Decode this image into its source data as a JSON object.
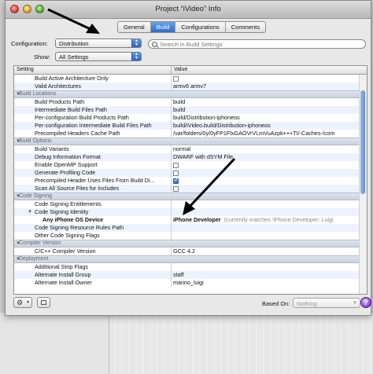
{
  "window": {
    "title": "Project “iVideo” Info"
  },
  "tabs": [
    {
      "label": "General",
      "active": false
    },
    {
      "label": "Build",
      "active": true
    },
    {
      "label": "Configurations",
      "active": false
    },
    {
      "label": "Comments",
      "active": false
    }
  ],
  "configuration": {
    "label": "Configuration:",
    "value": "Distribution"
  },
  "show": {
    "label": "Show:",
    "value": "All Settings"
  },
  "search": {
    "placeholder": "Search in Build Settings"
  },
  "table": {
    "col_setting": "Setting",
    "col_value": "Value",
    "rows": [
      {
        "type": "item",
        "name": "Build Active Architecture Only",
        "checkbox": true,
        "checked": false
      },
      {
        "type": "item",
        "name": "Valid Architectures",
        "value": "armv6 armv7"
      },
      {
        "type": "section",
        "name": "Build Locations"
      },
      {
        "type": "item",
        "name": "Build Products Path",
        "value": "build"
      },
      {
        "type": "item",
        "name": "Intermediate Build Files Path",
        "value": "build"
      },
      {
        "type": "item",
        "name": "Per-configuration Build Products Path",
        "value": "build/Distribution-iphoneos"
      },
      {
        "type": "item",
        "name": "Per-configuration Intermediate Build Files Path",
        "value": "build/iVideo.build/Distribution-iphoneos"
      },
      {
        "type": "item",
        "name": "Precompiled Headers Cache Path",
        "value": "/var/folders/0y/0yFP1FlxGAOVrVLmVuAzpk+++TI/-Caches-/com"
      },
      {
        "type": "section",
        "name": "Build Options"
      },
      {
        "type": "item",
        "name": "Build Variants",
        "value": "normal"
      },
      {
        "type": "item",
        "name": "Debug Information Format",
        "value": "DWARF with dSYM File"
      },
      {
        "type": "item",
        "name": "Enable OpenMP Support",
        "checkbox": true,
        "checked": false
      },
      {
        "type": "item",
        "name": "Generate Profiling Code",
        "checkbox": true,
        "checked": false
      },
      {
        "type": "item",
        "name": "Precompiled Header Uses Files From Build Di...",
        "checkbox": true,
        "checked": true
      },
      {
        "type": "item",
        "name": "Scan All Source Files for Includes",
        "checkbox": true,
        "checked": false
      },
      {
        "type": "section",
        "name": "Code Signing"
      },
      {
        "type": "item",
        "name": "Code Signing Entitlements",
        "value": ""
      },
      {
        "type": "item",
        "name": "Code Signing Identity",
        "value": "",
        "expander": true
      },
      {
        "type": "bold",
        "name": "Any iPhone OS Device",
        "value": "iPhone Developer",
        "hint": "(currently matches 'iPhone Developer: Luigi"
      },
      {
        "type": "item",
        "name": "Code Signing Resource Rules Path",
        "value": ""
      },
      {
        "type": "item",
        "name": "Other Code Signing Flags",
        "value": ""
      },
      {
        "type": "section",
        "name": "Compiler Version"
      },
      {
        "type": "item",
        "name": "C/C++ Compiler Version",
        "value": "GCC 4.2"
      },
      {
        "type": "section",
        "name": "Deployment"
      },
      {
        "type": "item",
        "name": "Additional Strip Flags",
        "value": ""
      },
      {
        "type": "item",
        "name": "Alternate Install Group",
        "value": "staff"
      },
      {
        "type": "item",
        "name": "Alternate Install Owner",
        "value": "marino_luigi"
      }
    ]
  },
  "bottom": {
    "based_on_label": "Based On:",
    "based_on_value": "Nothing",
    "help": "?"
  },
  "colors": {
    "accent": "#2f6bcc",
    "section_bg": "#c9d1dd",
    "alt_row": "#edf3fe",
    "arrow": "#000000"
  },
  "icons": {
    "gear": "gear-icon",
    "calculator": "calculator-icon",
    "help": "help-icon",
    "search": "search-icon"
  }
}
